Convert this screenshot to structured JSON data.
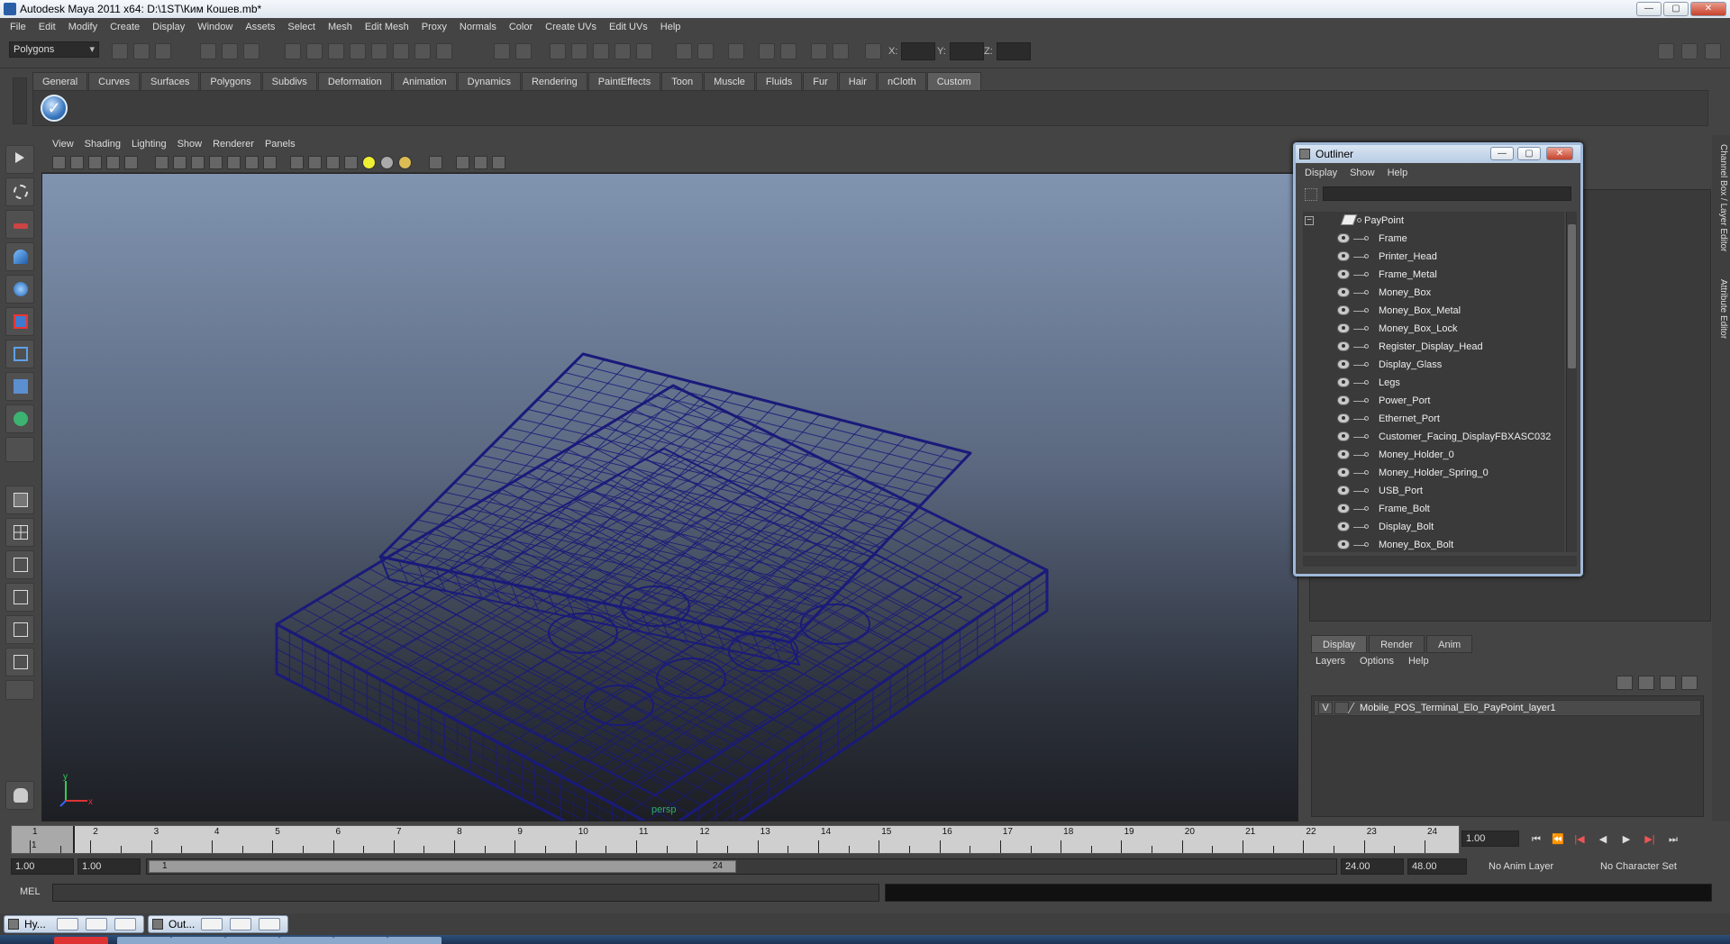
{
  "window": {
    "title": "Autodesk Maya 2011 x64: D:\\1ST\\Ким Кошев.mb*",
    "btn_min": "—",
    "btn_max": "▢",
    "btn_close": "✕"
  },
  "menubar": [
    "File",
    "Edit",
    "Modify",
    "Create",
    "Display",
    "Window",
    "Assets",
    "Select",
    "Mesh",
    "Edit Mesh",
    "Proxy",
    "Normals",
    "Color",
    "Create UVs",
    "Edit UVs",
    "Help"
  ],
  "statusline": {
    "mode": "Polygons",
    "x_label": "X:",
    "y_label": "Y:",
    "z_label": "Z:"
  },
  "shelf": {
    "tabs": [
      "General",
      "Curves",
      "Surfaces",
      "Polygons",
      "Subdivs",
      "Deformation",
      "Animation",
      "Dynamics",
      "Rendering",
      "PaintEffects",
      "Toon",
      "Muscle",
      "Fluids",
      "Fur",
      "Hair",
      "nCloth",
      "Custom"
    ],
    "active_tab": "Custom",
    "icon_glyph": "✓"
  },
  "viewport": {
    "menus": [
      "View",
      "Shading",
      "Lighting",
      "Show",
      "Renderer",
      "Panels"
    ],
    "camera_label": "persp",
    "axis_y": "y",
    "axis_x": "x",
    "wire_color": "#1a1a7a"
  },
  "outliner": {
    "title": "Outliner",
    "menus": [
      "Display",
      "Show",
      "Help"
    ],
    "collapse_glyph": "−",
    "root": "PayPoint",
    "items": [
      "Frame",
      "Printer_Head",
      "Frame_Metal",
      "Money_Box",
      "Money_Box_Metal",
      "Money_Box_Lock",
      "Register_Display_Head",
      "Display_Glass",
      "Legs",
      "Power_Port",
      "Ethernet_Port",
      "Customer_Facing_DisplayFBXASC032",
      "Money_Holder_0",
      "Money_Holder_Spring_0",
      "USB_Port",
      "Frame_Bolt",
      "Display_Bolt",
      "Money_Box_Bolt"
    ],
    "btn_min": "—",
    "btn_max": "▢",
    "btn_close": "✕"
  },
  "layer_editor": {
    "tabs": [
      "Display",
      "Render",
      "Anim"
    ],
    "active_tab": "Display",
    "menus": [
      "Layers",
      "Options",
      "Help"
    ],
    "layer_visible": "V",
    "layer_name": "Mobile_POS_Terminal_Elo_PayPoint_layer1"
  },
  "side_tabs": {
    "channel_box": "Channel Box / Layer Editor",
    "attribute_editor": "Attribute Editor"
  },
  "timeslider": {
    "ticks": [
      "1",
      "2",
      "3",
      "4",
      "5",
      "6",
      "7",
      "8",
      "9",
      "10",
      "11",
      "12",
      "13",
      "14",
      "15",
      "16",
      "17",
      "18",
      "19",
      "20",
      "21",
      "22",
      "23",
      "24"
    ],
    "current_frame": "1",
    "current_time_field": "1.00",
    "playback": {
      "go_start": "⏮",
      "step_back_key": "⏪",
      "step_back": "|◀",
      "play_back": "◀",
      "play_fwd": "▶",
      "step_fwd": "▶|",
      "go_end": "⏭"
    }
  },
  "range": {
    "start_time": "1.00",
    "playback_start": "1.00",
    "thumb_start": "1",
    "thumb_end": "24",
    "playback_end": "24.00",
    "end_time": "48.00",
    "anim_layer": "No Anim Layer",
    "character_set": "No Character Set"
  },
  "command": {
    "label": "MEL"
  },
  "minimized": [
    {
      "label": "Hy..."
    },
    {
      "label": "Out..."
    }
  ]
}
